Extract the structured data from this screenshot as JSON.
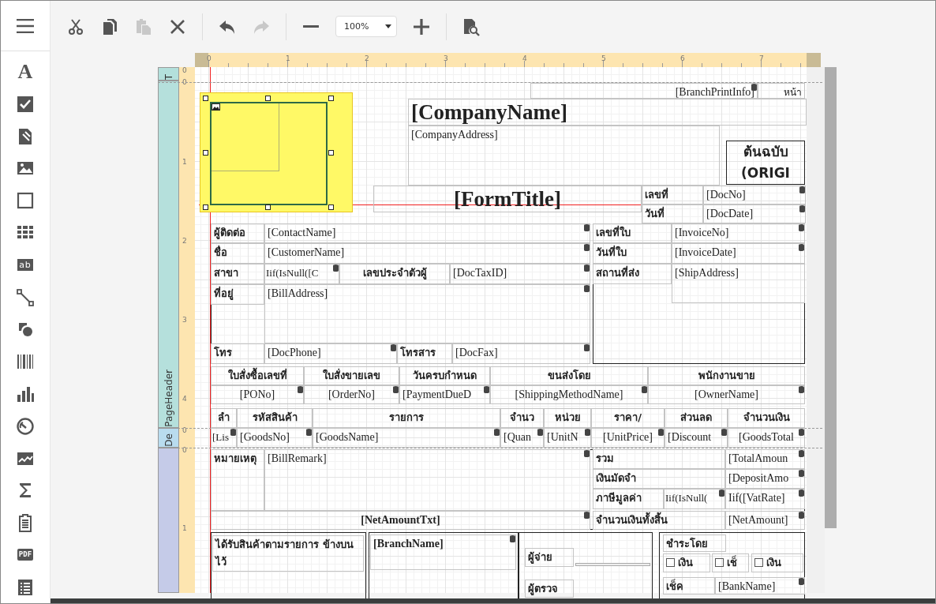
{
  "toolbar": [
    {
      "kind": "cut",
      "disabled": false
    },
    {
      "kind": "copy",
      "disabled": false
    },
    {
      "kind": "paste",
      "disabled": true
    },
    {
      "kind": "delete",
      "disabled": false
    },
    {
      "kind": "separator"
    },
    {
      "kind": "undo",
      "disabled": false
    },
    {
      "kind": "redo",
      "disabled": true
    },
    {
      "kind": "separator"
    },
    {
      "kind": "zoom-out",
      "disabled": false
    },
    {
      "kind": "zoom",
      "value": "100%"
    },
    {
      "kind": "zoom-in",
      "disabled": false
    },
    {
      "kind": "separator"
    },
    {
      "kind": "preview",
      "disabled": false
    }
  ],
  "palette": [
    {
      "kind": "text",
      "glyph": "A"
    },
    {
      "kind": "checkbox"
    },
    {
      "kind": "richtext"
    },
    {
      "kind": "picture"
    },
    {
      "kind": "rectangle"
    },
    {
      "kind": "table"
    },
    {
      "kind": "label",
      "glyph": "ab"
    },
    {
      "kind": "line"
    },
    {
      "kind": "shape"
    },
    {
      "kind": "barcode"
    },
    {
      "kind": "chart"
    },
    {
      "kind": "gauge"
    },
    {
      "kind": "sparkline"
    },
    {
      "kind": "sum"
    },
    {
      "kind": "clipboard"
    },
    {
      "kind": "pdf",
      "glyph": "PDF"
    },
    {
      "kind": "list"
    }
  ],
  "ruler": {
    "marks": [
      "0",
      "1",
      "2",
      "3",
      "4",
      "5",
      "6",
      "7"
    ]
  },
  "bands": [
    {
      "label": "T",
      "marks": [
        "0"
      ]
    },
    {
      "label": "PageHeader",
      "marks": [
        "0",
        "1",
        "2",
        "3",
        "4"
      ]
    },
    {
      "label": "De",
      "marks": [
        "0"
      ]
    },
    {
      "marks": [
        "0",
        "1"
      ]
    }
  ],
  "report": {
    "controls": [
      {
        "kind": "field",
        "text": "[BranchPrintInfo]"
      },
      {
        "kind": "text",
        "text": "หน้า"
      },
      {
        "kind": "title",
        "text": "[CompanyName]"
      },
      {
        "kind": "field",
        "text": "[CompanyAddress]"
      },
      {
        "kind": "stamp",
        "text": "ต้นฉบับ"
      },
      {
        "kind": "stamp",
        "text": "(ORIGI"
      },
      {
        "kind": "title",
        "text": "[FormTitle]"
      },
      {
        "kind": "label",
        "text": "เลขที่"
      },
      {
        "kind": "field",
        "text": "[DocNo]"
      },
      {
        "kind": "label",
        "text": "วันที่"
      },
      {
        "kind": "field",
        "text": "[DocDate]"
      },
      {
        "kind": "label",
        "text": "ผู้ติดต่อ"
      },
      {
        "kind": "field",
        "text": "[ContactName]"
      },
      {
        "kind": "label",
        "text": "เลขที่ใบ"
      },
      {
        "kind": "field",
        "text": "[InvoiceNo]"
      },
      {
        "kind": "label",
        "text": "ชื่อ"
      },
      {
        "kind": "field",
        "text": "[CustomerName]"
      },
      {
        "kind": "label",
        "text": "วันที่ใบ"
      },
      {
        "kind": "field",
        "text": "[InvoiceDate]"
      },
      {
        "kind": "label",
        "text": "สาขา"
      },
      {
        "kind": "field",
        "text": "Iif(IsNull([C"
      },
      {
        "kind": "label",
        "text": "เลขประจำตัวผู้"
      },
      {
        "kind": "field",
        "text": "[DocTaxID]"
      },
      {
        "kind": "label",
        "text": "สถานที่ส่ง"
      },
      {
        "kind": "field",
        "text": "[ShipAddress]"
      },
      {
        "kind": "label",
        "text": "ที่อยู่"
      },
      {
        "kind": "field",
        "text": "[BillAddress]"
      },
      {
        "kind": "label",
        "text": "โทร"
      },
      {
        "kind": "field",
        "text": "[DocPhone]"
      },
      {
        "kind": "label",
        "text": "โทรสาร"
      },
      {
        "kind": "field",
        "text": "[DocFax]"
      },
      {
        "kind": "heading",
        "text": "ใบสั่งซื้อเลขที่"
      },
      {
        "kind": "heading",
        "text": "ใบสั่งขายเลข"
      },
      {
        "kind": "heading",
        "text": "วันครบกำหนด"
      },
      {
        "kind": "heading",
        "text": "ขนส่งโดย"
      },
      {
        "kind": "heading",
        "text": "พนักงานขาย"
      },
      {
        "kind": "field",
        "text": "[PONo]"
      },
      {
        "kind": "field",
        "text": "[OrderNo]"
      },
      {
        "kind": "field",
        "text": "[PaymentDueD"
      },
      {
        "kind": "field",
        "text": "[ShippingMethodName]"
      },
      {
        "kind": "field",
        "text": "[OwnerName]"
      },
      {
        "kind": "heading",
        "text": "ลำ"
      },
      {
        "kind": "heading",
        "text": "รหัสสินค้า"
      },
      {
        "kind": "heading",
        "text": "รายการ"
      },
      {
        "kind": "heading",
        "text": "จำนว"
      },
      {
        "kind": "heading",
        "text": "หน่วย"
      },
      {
        "kind": "heading",
        "text": "ราคา/"
      },
      {
        "kind": "heading",
        "text": "ส่วนลด"
      },
      {
        "kind": "heading",
        "text": "จำนวนเงิน"
      },
      {
        "kind": "field",
        "text": "[Lis"
      },
      {
        "kind": "field",
        "text": "[GoodsNo]"
      },
      {
        "kind": "field",
        "text": "[GoodsName]"
      },
      {
        "kind": "field",
        "text": "[Quan"
      },
      {
        "kind": "field",
        "text": "[UnitN"
      },
      {
        "kind": "field",
        "text": "[UnitPrice]"
      },
      {
        "kind": "field",
        "text": "[Discount"
      },
      {
        "kind": "field",
        "text": "[GoodsTotal"
      },
      {
        "kind": "label",
        "text": "หมายเหตุ"
      },
      {
        "kind": "field",
        "text": "[BillRemark]"
      },
      {
        "kind": "label",
        "text": "รวม"
      },
      {
        "kind": "field",
        "text": "[TotalAmoun"
      },
      {
        "kind": "label",
        "text": "เงินมัดจำ"
      },
      {
        "kind": "field",
        "text": "[DepositAmo"
      },
      {
        "kind": "label",
        "text": "ภาษีมูลค่า"
      },
      {
        "kind": "field",
        "text": "Iif(IsNull("
      },
      {
        "kind": "field",
        "text": "Iif([VatRate]"
      },
      {
        "kind": "field",
        "text": "[NetAmountTxt]"
      },
      {
        "kind": "label",
        "text": "จำนวนเงินทั้งสิ้น"
      },
      {
        "kind": "field",
        "text": "[NetAmount]"
      },
      {
        "kind": "label",
        "text": "ได้รับสินค้าตามรายการ ข้างบนไว้"
      },
      {
        "kind": "field",
        "text": "[BranchName]"
      },
      {
        "kind": "label",
        "text": "ผู้จ่าย"
      },
      {
        "kind": "label",
        "text": "ผู้ตรวจ"
      },
      {
        "kind": "label",
        "text": "ชำระโดย"
      },
      {
        "kind": "checkbox",
        "text": "เงิน",
        "checked": false
      },
      {
        "kind": "checkbox",
        "text": "เช็",
        "checked": false
      },
      {
        "kind": "checkbox",
        "text": "เงิน",
        "checked": false
      },
      {
        "kind": "label",
        "text": "เช็ค"
      },
      {
        "kind": "field",
        "text": "[BankName]"
      }
    ]
  }
}
